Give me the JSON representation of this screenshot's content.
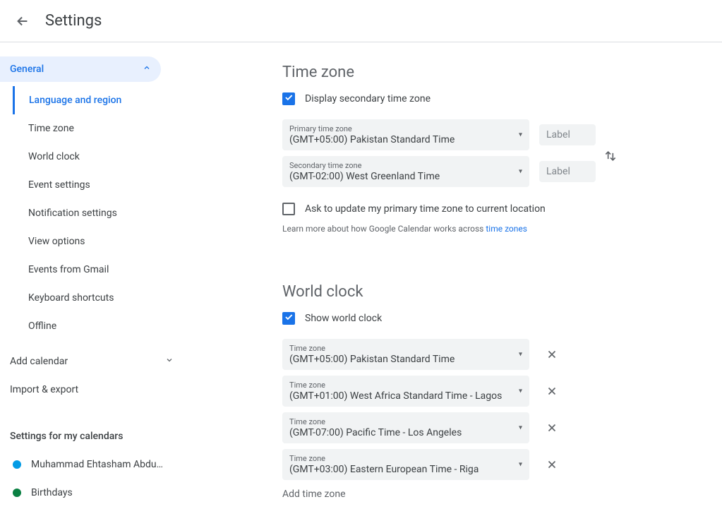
{
  "header": {
    "title": "Settings"
  },
  "sidebar": {
    "general": "General",
    "subnav": [
      "Language and region",
      "Time zone",
      "World clock",
      "Event settings",
      "Notification settings",
      "View options",
      "Events from Gmail",
      "Keyboard shortcuts",
      "Offline"
    ],
    "add_calendar": "Add calendar",
    "import_export": "Import & export",
    "settings_heading": "Settings for my calendars",
    "calendars": [
      {
        "name": "Muhammad Ehtasham Abdu…",
        "color": "#039be5"
      },
      {
        "name": "Birthdays",
        "color": "#0b8043"
      }
    ]
  },
  "timezone": {
    "title": "Time zone",
    "display_secondary": "Display secondary time zone",
    "primary_label": "Primary time zone",
    "primary_value": "(GMT+05:00) Pakistan Standard Time",
    "secondary_label": "Secondary time zone",
    "secondary_value": "(GMT-02:00) West Greenland Time",
    "label_placeholder": "Label",
    "ask_update": "Ask to update my primary time zone to current location",
    "helper_text": "Learn more about how Google Calendar works across ",
    "helper_link": "time zones"
  },
  "worldclock": {
    "title": "World clock",
    "show": "Show world clock",
    "tz_label": "Time zone",
    "clocks": [
      "(GMT+05:00) Pakistan Standard Time",
      "(GMT+01:00) West Africa Standard Time - Lagos",
      "(GMT-07:00) Pacific Time - Los Angeles",
      "(GMT+03:00) Eastern European Time - Riga"
    ],
    "add": "Add time zone"
  }
}
